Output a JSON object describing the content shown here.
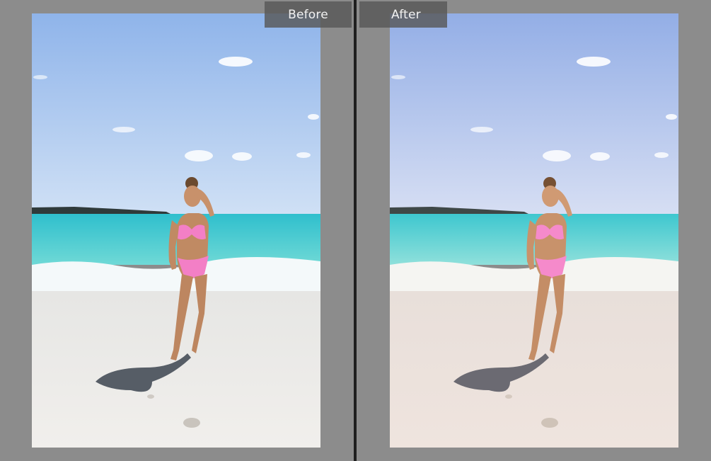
{
  "comparison": {
    "before_label": "Before",
    "after_label": "After"
  },
  "photo": {
    "subject": "beach-portrait",
    "icons": [
      "photo-before",
      "photo-after"
    ]
  },
  "colors": {
    "background": "#8c8c8c",
    "divider": "#1f1f1f",
    "label_bg": "#585858",
    "label_text": "#f2f2f2",
    "before_sky_top": "#8fb4ea",
    "before_sky_bottom": "#cfe0f5",
    "after_sky_top": "#93aee6",
    "after_sky_bottom": "#d6def3",
    "sea": "#45c9cf",
    "before_sand": "#eceae7",
    "after_sand": "#ece2dc",
    "swimsuit": "#f37fc6"
  }
}
